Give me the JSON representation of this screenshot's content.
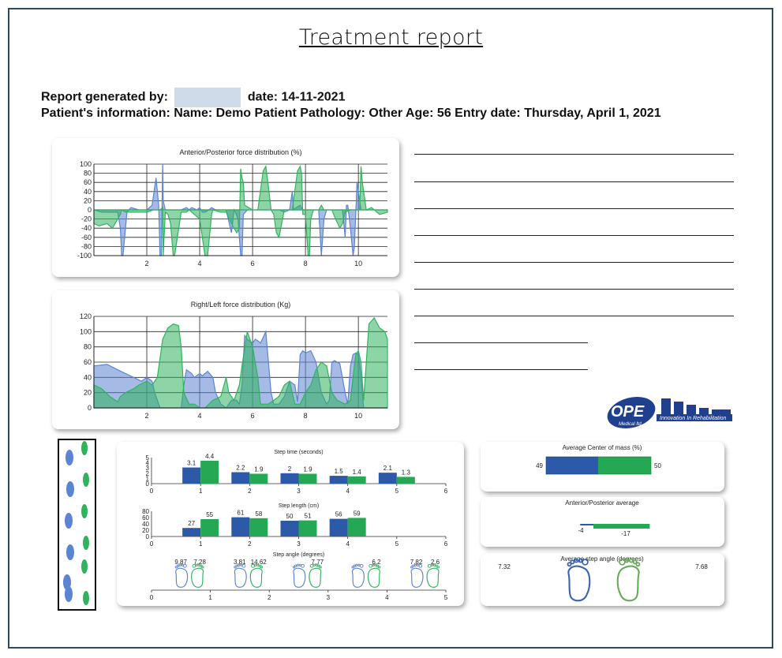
{
  "report": {
    "title": "Treatment report",
    "generated_label": "Report generated by:",
    "date_text": "date: 14-11-2021",
    "patient_text": "Patient's information:   Name: Demo Patient  Pathology: Other  Age: 56  Entry date: Thursday, April 1, 2021"
  },
  "logo": {
    "name": "OPE",
    "sub": "Medical ltd.",
    "tagline": "Innovation In Rehabilitation",
    "color": "#1f3f8f"
  },
  "colors": {
    "blue": "#5b84d2",
    "green": "#2fb35c",
    "dark_blue": "#2c5aa8",
    "dark_green": "#25a853",
    "frame": "#2f4a5c"
  },
  "chart_data": [
    {
      "type": "area",
      "title": "Anterior/Posterior force distribution (%)",
      "xlim": [
        0,
        11.1
      ],
      "ylim": [
        -100,
        100
      ],
      "yticks": [
        "100",
        "80",
        "60",
        "40",
        "20",
        "0",
        "-20",
        "-40",
        "-60",
        "-80",
        "-100"
      ],
      "xticks": [
        "2",
        "4",
        "6",
        "8",
        "10"
      ],
      "grid": true,
      "series": [
        {
          "color": "#5b84d2",
          "x": [
            0,
            0.3,
            0.6,
            0.9,
            1.0,
            1.05,
            1.1,
            1.25,
            1.4,
            1.7,
            2.0,
            2.2,
            2.3,
            2.35,
            2.45,
            2.5,
            2.55,
            2.6,
            2.62,
            2.7,
            2.8,
            3.0,
            3.3,
            3.5,
            3.6,
            3.7,
            3.9,
            4.0,
            4.05,
            4.1,
            4.2,
            4.35,
            4.45,
            4.6,
            4.8,
            5.0,
            5.2,
            5.3,
            5.35,
            5.45,
            5.55,
            5.6,
            5.65,
            5.8,
            6.0,
            6.3,
            6.6,
            6.8,
            7.0,
            7.2,
            7.4,
            7.5,
            7.55,
            7.65,
            7.8,
            7.9,
            8.0,
            8.3,
            8.5,
            8.6,
            8.7,
            8.8,
            9.0,
            9.2,
            9.4,
            9.5,
            9.55,
            9.6,
            9.7,
            9.8,
            9.85,
            9.95,
            10.1,
            10.2,
            10.5,
            11.1
          ],
          "y": [
            0,
            -5,
            -5,
            -5,
            -40,
            -100,
            -100,
            -5,
            5,
            0,
            0,
            10,
            50,
            70,
            10,
            -100,
            -100,
            100,
            20,
            0,
            0,
            0,
            0,
            5,
            0,
            5,
            0,
            5,
            0,
            -5,
            -5,
            0,
            5,
            0,
            0,
            0,
            -50,
            0,
            -5,
            -20,
            -100,
            -100,
            -10,
            0,
            0,
            0,
            0,
            0,
            0,
            -5,
            0,
            40,
            0,
            5,
            10,
            0,
            0,
            0,
            0,
            -100,
            -20,
            0,
            0,
            0,
            0,
            -60,
            10,
            10,
            -40,
            -100,
            -80,
            60,
            0,
            0,
            0,
            0
          ]
        },
        {
          "color": "#2fb35c",
          "x": [
            0,
            0.2,
            0.5,
            0.7,
            1.0,
            1.05,
            1.2,
            1.5,
            2.0,
            2.25,
            2.4,
            2.5,
            2.6,
            2.62,
            2.7,
            2.8,
            2.9,
            3.0,
            3.05,
            3.3,
            3.5,
            3.6,
            3.7,
            4.0,
            4.2,
            4.3,
            4.45,
            4.5,
            4.8,
            5.0,
            5.2,
            5.4,
            5.5,
            5.55,
            5.6,
            5.65,
            5.7,
            6.0,
            6.2,
            6.4,
            6.5,
            6.6,
            6.7,
            6.8,
            6.9,
            7.0,
            7.1,
            7.2,
            7.5,
            7.7,
            7.8,
            7.85,
            7.9,
            8.0,
            8.1,
            8.15,
            8.2,
            8.3,
            8.5,
            8.6,
            8.7,
            8.8,
            9.0,
            9.1,
            9.3,
            9.4,
            9.5,
            9.7,
            9.9,
            10.0,
            10.05,
            10.1,
            10.15,
            10.3,
            10.5,
            10.8,
            11.1
          ],
          "y": [
            -30,
            -35,
            -30,
            -40,
            -10,
            0,
            -5,
            -5,
            -5,
            0,
            0,
            0,
            5,
            -100,
            -5,
            -10,
            -30,
            -100,
            -100,
            -5,
            -5,
            0,
            -5,
            -20,
            -100,
            -100,
            -10,
            0,
            -5,
            -5,
            -30,
            -50,
            -40,
            90,
            70,
            60,
            10,
            0,
            0,
            85,
            95,
            50,
            0,
            -10,
            -50,
            -60,
            -30,
            0,
            0,
            85,
            95,
            80,
            -10,
            -10,
            -100,
            -100,
            -20,
            0,
            0,
            10,
            0,
            0,
            0,
            -15,
            -40,
            -30,
            -5,
            0,
            0,
            0,
            0,
            95,
            60,
            0,
            5,
            -10,
            -5
          ]
        }
      ]
    },
    {
      "type": "area",
      "title": "Right/Left force distribution (Kg)",
      "xlim": [
        0,
        11.1
      ],
      "ylim": [
        0,
        120
      ],
      "yticks": [
        "120",
        "100",
        "80",
        "60",
        "40",
        "20",
        "0"
      ],
      "xticks": [
        "2",
        "4",
        "6",
        "8",
        "10"
      ],
      "grid": true,
      "series": [
        {
          "color": "#5b84d2",
          "x": [
            0,
            0.5,
            0.9,
            1.2,
            1.5,
            1.8,
            2.0,
            2.2,
            2.3,
            2.4,
            2.5,
            3.3,
            3.4,
            3.5,
            3.7,
            3.8,
            4.0,
            4.1,
            4.3,
            4.5,
            4.6,
            4.8,
            5.0,
            5.2,
            5.4,
            5.5,
            5.6,
            5.7,
            5.8,
            6.0,
            6.1,
            6.2,
            6.3,
            6.5,
            6.6,
            6.7,
            6.8,
            7.0,
            7.2,
            7.4,
            7.6,
            7.7,
            7.8,
            7.9,
            8.0,
            8.2,
            8.4,
            8.6,
            8.8,
            8.9,
            9.0,
            9.1,
            9.3,
            9.5,
            9.6,
            9.7,
            9.8,
            9.9,
            10.0,
            10.1,
            10.2,
            11.1
          ],
          "y": [
            55,
            57,
            50,
            45,
            40,
            35,
            40,
            35,
            20,
            10,
            0,
            0,
            30,
            50,
            45,
            40,
            45,
            42,
            48,
            40,
            20,
            5,
            0,
            10,
            10,
            5,
            30,
            95,
            90,
            85,
            90,
            88,
            85,
            100,
            60,
            20,
            5,
            5,
            15,
            35,
            30,
            8,
            70,
            75,
            72,
            75,
            60,
            20,
            5,
            10,
            60,
            62,
            58,
            20,
            5,
            55,
            70,
            72,
            70,
            40,
            0,
            0
          ]
        },
        {
          "color": "#2fb35c",
          "x": [
            0,
            0.3,
            0.6,
            0.9,
            1.0,
            1.2,
            1.5,
            1.7,
            2.0,
            2.2,
            2.4,
            2.6,
            2.8,
            3.0,
            3.2,
            3.3,
            3.4,
            3.6,
            3.8,
            4.0,
            4.2,
            4.5,
            4.8,
            5.0,
            5.1,
            5.3,
            5.5,
            5.6,
            5.8,
            6.0,
            6.2,
            6.3,
            6.6,
            6.8,
            7.0,
            7.2,
            7.4,
            7.6,
            7.8,
            8.0,
            8.2,
            8.4,
            8.6,
            8.8,
            9.0,
            9.2,
            9.5,
            9.7,
            9.9,
            10.0,
            10.1,
            10.2,
            10.4,
            10.6,
            10.8,
            11.0,
            11.1
          ],
          "y": [
            30,
            25,
            15,
            8,
            15,
            20,
            25,
            30,
            35,
            30,
            40,
            90,
            105,
            110,
            108,
            80,
            20,
            5,
            5,
            0,
            0,
            10,
            15,
            40,
            20,
            10,
            30,
            55,
            100,
            80,
            40,
            5,
            5,
            10,
            15,
            30,
            35,
            5,
            5,
            20,
            30,
            50,
            60,
            55,
            20,
            10,
            5,
            10,
            70,
            75,
            60,
            10,
            110,
            118,
            105,
            100,
            90
          ]
        }
      ]
    },
    {
      "type": "bar",
      "title": "Step time (seconds)",
      "categories": [
        "1",
        "2",
        "3",
        "4",
        "5"
      ],
      "xticks": [
        "0",
        "1",
        "2",
        "3",
        "4",
        "5",
        "6"
      ],
      "yticks": [
        "5",
        "4",
        "3",
        "2",
        "1",
        "0"
      ],
      "ylim": [
        0,
        5
      ],
      "series": [
        {
          "color": "#2c5aa8",
          "values": [
            3.1,
            2.2,
            2,
            1.5,
            2.1
          ],
          "labels": [
            "3.1",
            "2.2",
            "2",
            "1.5",
            "2.1"
          ]
        },
        {
          "color": "#25a853",
          "values": [
            4.4,
            1.9,
            1.9,
            1.4,
            1.3
          ],
          "labels": [
            "4.4",
            "1.9",
            "1.9",
            "1.4",
            "1.3"
          ]
        }
      ]
    },
    {
      "type": "bar",
      "title": "Step length (cm)",
      "categories": [
        "1",
        "2",
        "3",
        "4"
      ],
      "xticks": [
        "0",
        "1",
        "2",
        "3",
        "4",
        "5",
        "6"
      ],
      "yticks": [
        "80",
        "60",
        "40",
        "20",
        "0"
      ],
      "ylim": [
        0,
        80
      ],
      "series": [
        {
          "color": "#2c5aa8",
          "values": [
            27,
            61,
            50,
            56
          ],
          "labels": [
            "27",
            "61",
            "50",
            "56"
          ]
        },
        {
          "color": "#25a853",
          "values": [
            55,
            58,
            51,
            59
          ],
          "labels": [
            "55",
            "58",
            "51",
            "59"
          ]
        }
      ]
    },
    {
      "type": "table",
      "title": "Step angle (degrees)",
      "xticks": [
        "0",
        "1",
        "2",
        "3",
        "4",
        "5"
      ],
      "pairs": [
        {
          "left": "9.87",
          "right": "7.28"
        },
        {
          "left": "3.81",
          "right": "14.62"
        },
        {
          "left": "",
          "right": "7.77"
        },
        {
          "left": "",
          "right": "6.2"
        },
        {
          "left": "7.82",
          "right": "2.6"
        }
      ]
    },
    {
      "type": "bar",
      "title": "Average Center of mass (%)",
      "series": [
        {
          "color": "#2c5aa8",
          "value": 49,
          "label": "49"
        },
        {
          "color": "#25a853",
          "value": 50,
          "label": "50"
        }
      ]
    },
    {
      "type": "bar",
      "title": "Anterior/Posterior average",
      "series": [
        {
          "color": "#2c5aa8",
          "value": -4,
          "label": "-4"
        },
        {
          "color": "#25a853",
          "value": -17,
          "label": "-17"
        }
      ]
    },
    {
      "type": "table",
      "title": "Average step angle (degrees)",
      "left_value": "7.32",
      "right_value": "7.68"
    }
  ],
  "footprint_strip": {
    "blue_count": 6,
    "green_count": 6
  }
}
